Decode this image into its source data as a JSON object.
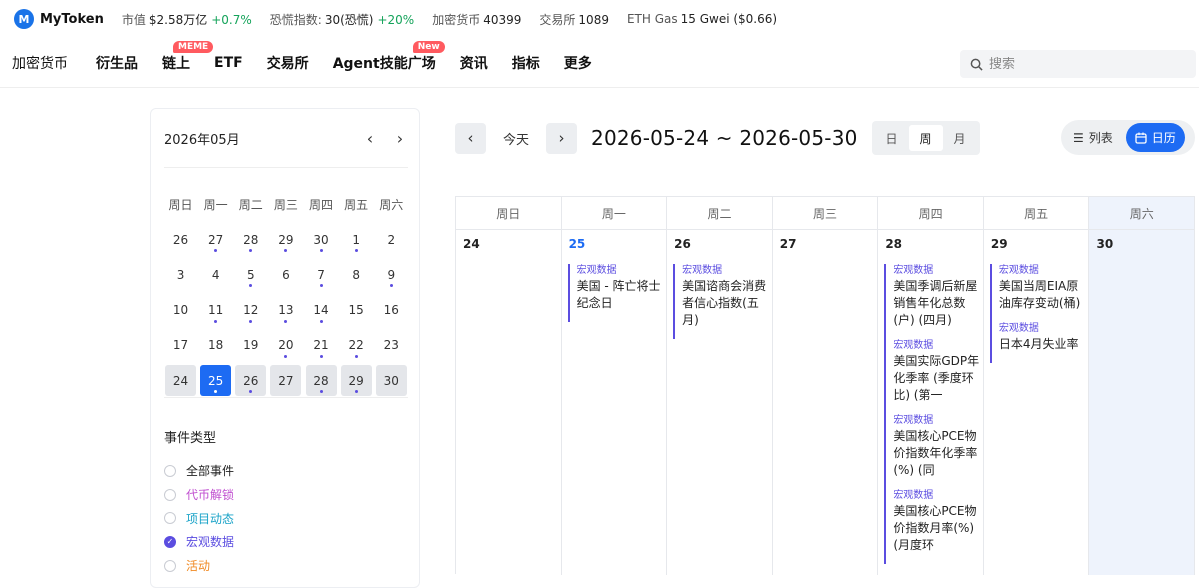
{
  "ticker": {
    "brand": "MyToken",
    "logo_letter": "M",
    "items": [
      {
        "label": "市值",
        "value": "$2.58万亿",
        "change": "+0.7%"
      },
      {
        "label": "恐慌指数:",
        "value": "30(恐慌)",
        "change": "+20%"
      },
      {
        "label": "加密货币",
        "value": "40399",
        "change": ""
      },
      {
        "label": "交易所",
        "value": "1089",
        "change": ""
      },
      {
        "label": "ETH Gas",
        "value": "15 Gwei ($0.66)",
        "change": ""
      }
    ]
  },
  "nav": {
    "items": [
      "加密货币",
      "衍生品",
      "链上",
      "ETF",
      "交易所",
      "Agent技能广场",
      "资讯",
      "指标",
      "更多"
    ],
    "badge_onchain": "MEME",
    "badge_agent": "New",
    "search_placeholder": "搜索"
  },
  "mini_calendar": {
    "title": "2026年05月",
    "weekdays": [
      "周日",
      "周一",
      "周二",
      "周三",
      "周四",
      "周五",
      "周六"
    ],
    "weeks": [
      [
        {
          "d": "26",
          "dot": false
        },
        {
          "d": "27",
          "dot": true
        },
        {
          "d": "28",
          "dot": true
        },
        {
          "d": "29",
          "dot": true
        },
        {
          "d": "30",
          "dot": true
        },
        {
          "d": "1",
          "dot": true
        },
        {
          "d": "2",
          "dot": false
        }
      ],
      [
        {
          "d": "3",
          "dot": false
        },
        {
          "d": "4",
          "dot": false
        },
        {
          "d": "5",
          "dot": true
        },
        {
          "d": "6",
          "dot": false
        },
        {
          "d": "7",
          "dot": true
        },
        {
          "d": "8",
          "dot": false
        },
        {
          "d": "9",
          "dot": true
        }
      ],
      [
        {
          "d": "10",
          "dot": false
        },
        {
          "d": "11",
          "dot": true
        },
        {
          "d": "12",
          "dot": true
        },
        {
          "d": "13",
          "dot": true
        },
        {
          "d": "14",
          "dot": true
        },
        {
          "d": "15",
          "dot": false
        },
        {
          "d": "16",
          "dot": false
        }
      ],
      [
        {
          "d": "17",
          "dot": false
        },
        {
          "d": "18",
          "dot": false
        },
        {
          "d": "19",
          "dot": false
        },
        {
          "d": "20",
          "dot": true
        },
        {
          "d": "21",
          "dot": true
        },
        {
          "d": "22",
          "dot": true
        },
        {
          "d": "23",
          "dot": false
        }
      ],
      [
        {
          "d": "24",
          "dot": false
        },
        {
          "d": "25",
          "dot": true
        },
        {
          "d": "26",
          "dot": true
        },
        {
          "d": "27",
          "dot": false
        },
        {
          "d": "28",
          "dot": true
        },
        {
          "d": "29",
          "dot": true
        },
        {
          "d": "30",
          "dot": false
        }
      ]
    ],
    "selected_week_index": 4,
    "today": "25"
  },
  "event_types": {
    "title": "事件类型",
    "items": [
      {
        "label": "全部事件",
        "color": "#222222",
        "checked": false
      },
      {
        "label": "代币解锁",
        "color": "#c04fd0",
        "checked": false
      },
      {
        "label": "项目动态",
        "color": "#1aa3c8",
        "checked": false
      },
      {
        "label": "宏观数据",
        "color": "#5b4de0",
        "checked": true
      },
      {
        "label": "活动",
        "color": "#f08a24",
        "checked": false
      }
    ]
  },
  "toolbar": {
    "prev_icon": "‹",
    "next_icon": "›",
    "today_label": "今天",
    "range": "2026-05-24 ~ 2026-05-30",
    "scale": [
      "日",
      "周",
      "月"
    ],
    "scale_active": "周",
    "list_label": "列表",
    "calendar_label": "日历"
  },
  "week": {
    "headers": [
      "周日",
      "周一",
      "周二",
      "周三",
      "周四",
      "周五",
      "周六"
    ],
    "days": [
      {
        "date": "24",
        "events": []
      },
      {
        "date": "25",
        "current": true,
        "events": [
          {
            "cat": "宏观数据",
            "name": "美国 - 阵亡将士纪念日"
          }
        ]
      },
      {
        "date": "26",
        "events": [
          {
            "cat": "宏观数据",
            "name": "美国谘商会消费者信心指数(五月)"
          }
        ]
      },
      {
        "date": "27",
        "events": []
      },
      {
        "date": "28",
        "events": [
          {
            "cat": "宏观数据",
            "name": "美国季调后新屋销售年化总数(户) (四月)"
          },
          {
            "cat": "宏观数据",
            "name": "美国实际GDP年化季率 (季度环比) (第一"
          },
          {
            "cat": "宏观数据",
            "name": "美国核心PCE物价指数年化季率(%) (同"
          },
          {
            "cat": "宏观数据",
            "name": "美国核心PCE物价指数月率(%) (月度环"
          }
        ]
      },
      {
        "date": "29",
        "events": [
          {
            "cat": "宏观数据",
            "name": "美国当周EIA原油库存变动(桶)"
          },
          {
            "cat": "宏观数据",
            "name": "日本4月失业率"
          }
        ]
      },
      {
        "date": "30",
        "events": []
      }
    ]
  },
  "colors": {
    "accent": "#1d6bf3",
    "macro": "#5b4de0",
    "up": "#14a35a",
    "badge": "#ff5a5f"
  }
}
